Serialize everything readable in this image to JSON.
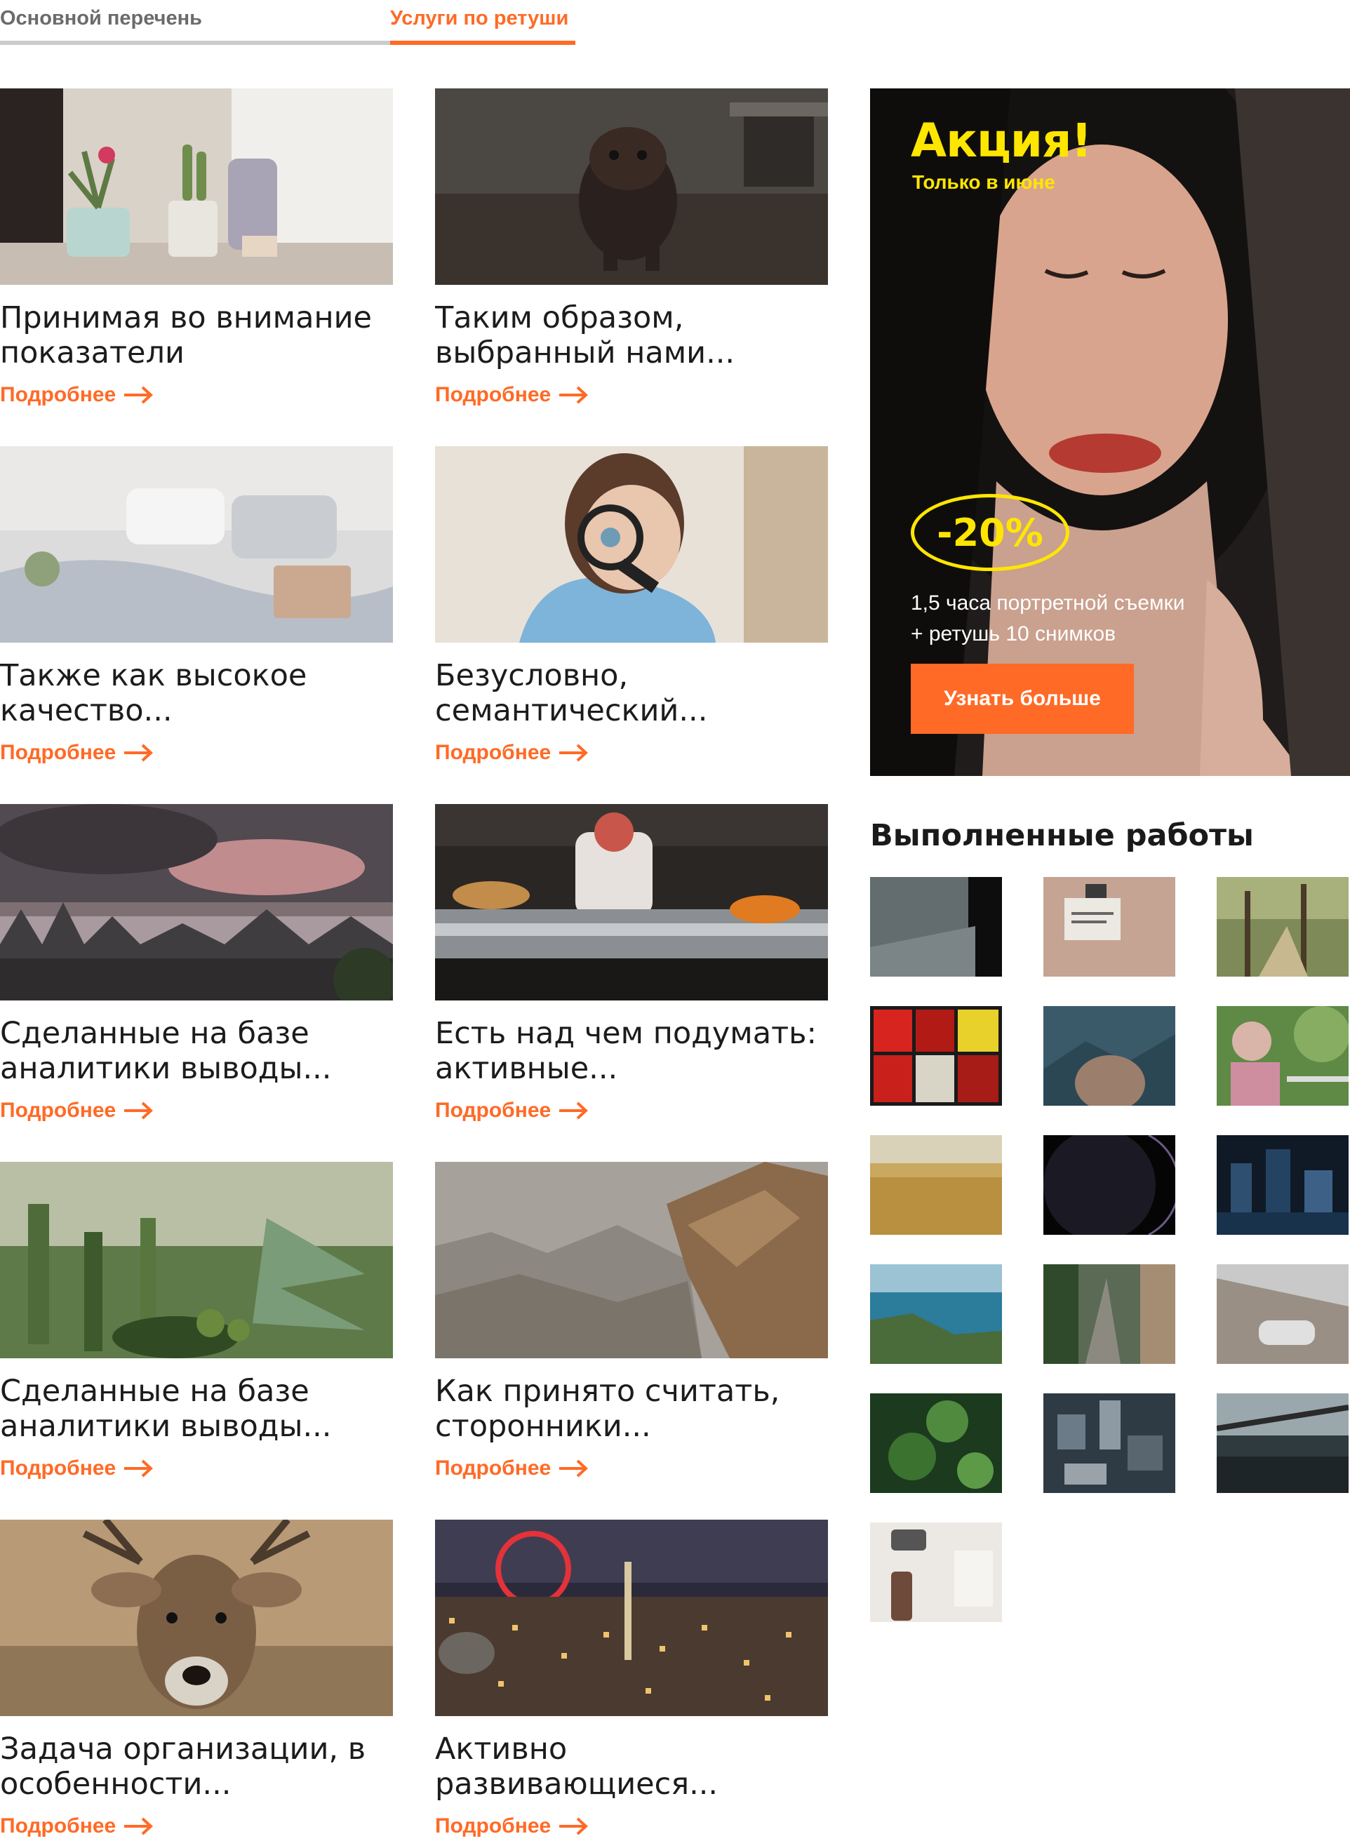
{
  "tabs": [
    {
      "label": "Основной перечень"
    },
    {
      "label": "Услуги по ретуши"
    }
  ],
  "more_label": "Подробнее",
  "cards": [
    {
      "title": "Принимая во внимание показатели",
      "image": "houseplants-on-windowsill-photo"
    },
    {
      "title": "Таким образом, выбранный нами...",
      "image": "puppy-running-photo"
    },
    {
      "title": "Также как высокое качество...",
      "image": "bed-with-laptop-photo"
    },
    {
      "title": "Безусловно, семантический...",
      "image": "child-with-magnifier-photo"
    },
    {
      "title": "Сделанные на базе аналитики выводы...",
      "image": "city-skyline-clouds-photo"
    },
    {
      "title": "Есть над чем подумать: активные...",
      "image": "restaurant-kitchen-chef-photo"
    },
    {
      "title": "Сделанные на базе аналитики выводы...",
      "image": "cactus-garden-photo"
    },
    {
      "title": "Как принято считать, сторонники...",
      "image": "canyon-rocks-photo"
    },
    {
      "title": "Задача организации, в особенности...",
      "image": "deer-portrait-photo"
    },
    {
      "title": "Активно развивающиеся...",
      "image": "london-night-city-photo"
    }
  ],
  "promo": {
    "title": "Акция!",
    "subtitle": "Только в июне",
    "discount": "-20%",
    "description_line1": "1,5 часа портретной съемки",
    "description_line2": "+ ретушь 10 снимков",
    "button_label": "Узнать больше",
    "image": "woman-portrait-photo"
  },
  "works": {
    "title": "Выполненные работы",
    "thumbnails": [
      "window-rain-photo",
      "notice-paper-photo",
      "palm-path-photo",
      "stained-glass-photo",
      "elephant-photo",
      "woman-in-garden-photo",
      "wheat-field-photo",
      "planet-eclipse-photo",
      "night-city-photo",
      "coastline-aerial-photo",
      "busy-street-photo",
      "car-highway-photo",
      "green-leaves-photo",
      "city-from-above-photo",
      "bridge-people-photo",
      "camera-desk-photo"
    ]
  },
  "colors": {
    "accent": "#ff6a26",
    "promo_yellow": "#ffe600",
    "tab_inactive": "#6b6b6b"
  }
}
